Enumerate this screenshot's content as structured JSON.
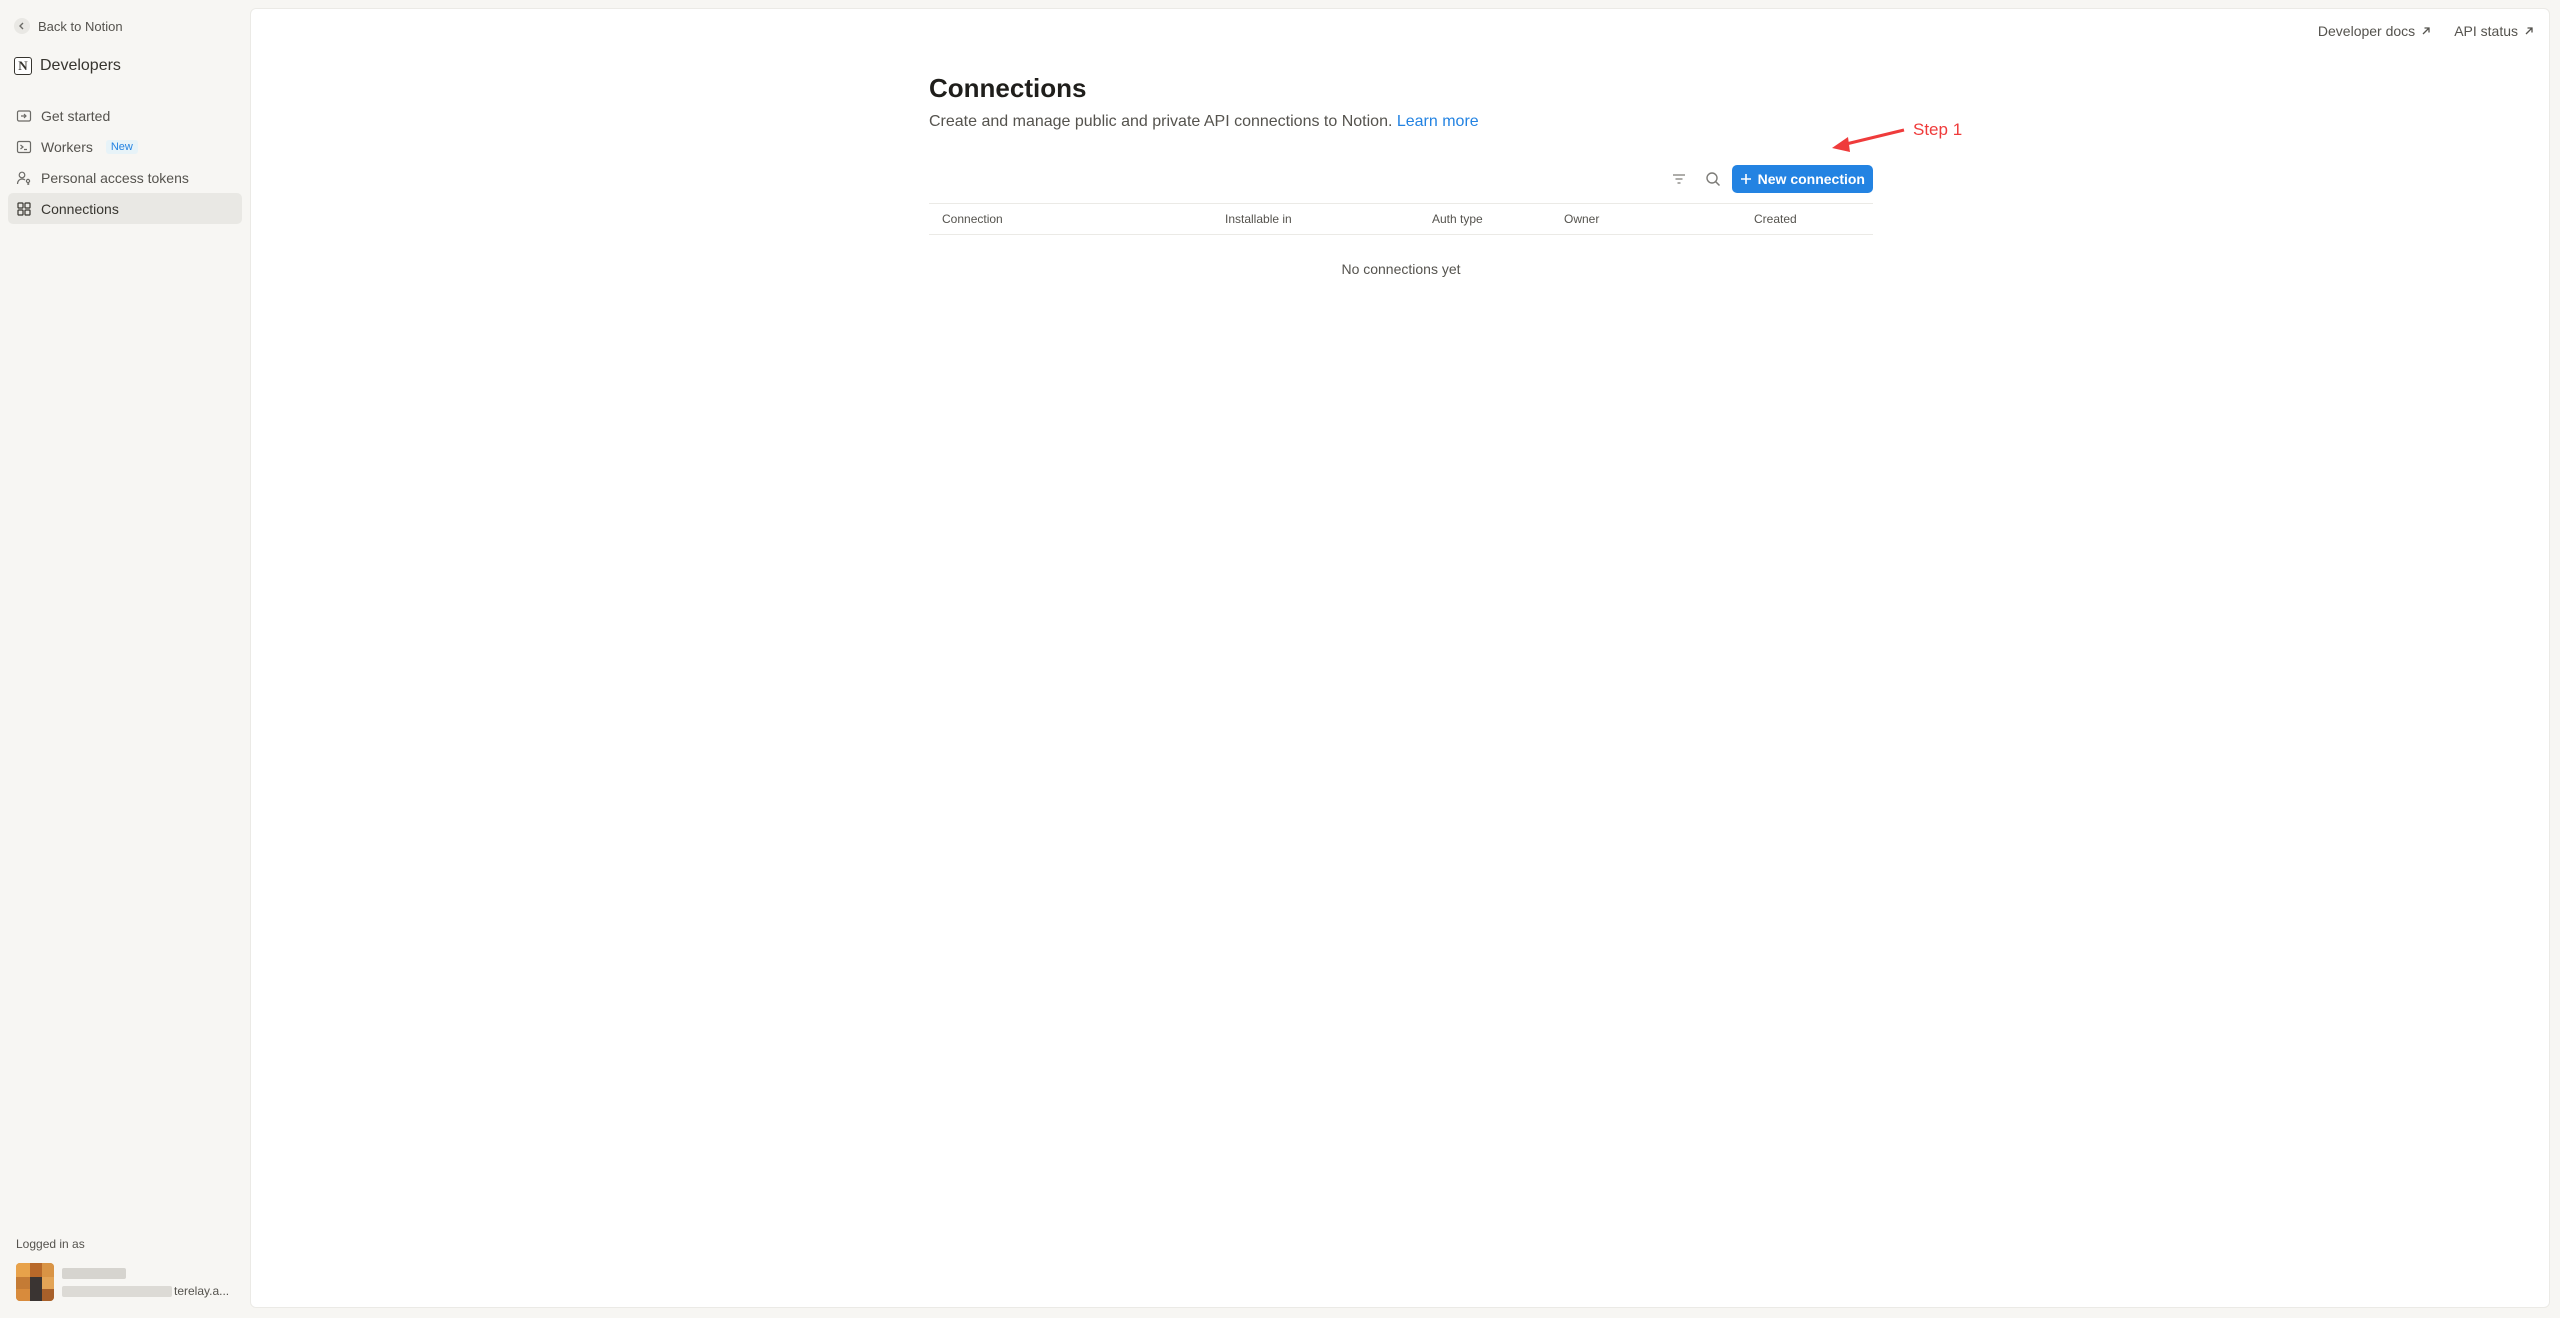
{
  "sidebar": {
    "back_label": "Back to Notion",
    "brand_title": "Developers",
    "items": [
      {
        "label": "Get started",
        "icon": "enter-icon"
      },
      {
        "label": "Workers",
        "icon": "terminal-icon",
        "badge": "New"
      },
      {
        "label": "Personal access tokens",
        "icon": "user-key-icon"
      },
      {
        "label": "Connections",
        "icon": "grid-icon",
        "active": true
      }
    ],
    "logged_in_label": "Logged in as",
    "email_visible_tail": "terelay.a..."
  },
  "header": {
    "links": [
      {
        "label": "Developer docs",
        "icon": "external-link-icon"
      },
      {
        "label": "API status",
        "icon": "external-link-icon"
      }
    ]
  },
  "main": {
    "title": "Connections",
    "subtitle": "Create and manage public and private API connections to Notion.",
    "learn_more": "Learn more",
    "new_button_label": "New connection",
    "table": {
      "columns": [
        "Connection",
        "Installable in",
        "Auth type",
        "Owner",
        "Created"
      ],
      "empty_text": "No connections yet"
    }
  },
  "annotation": {
    "label": "Step 1",
    "color": "#ef3b3b"
  },
  "colors": {
    "accent": "#2383e2",
    "sidebar_bg": "#f7f6f3",
    "text": "#37352f"
  }
}
